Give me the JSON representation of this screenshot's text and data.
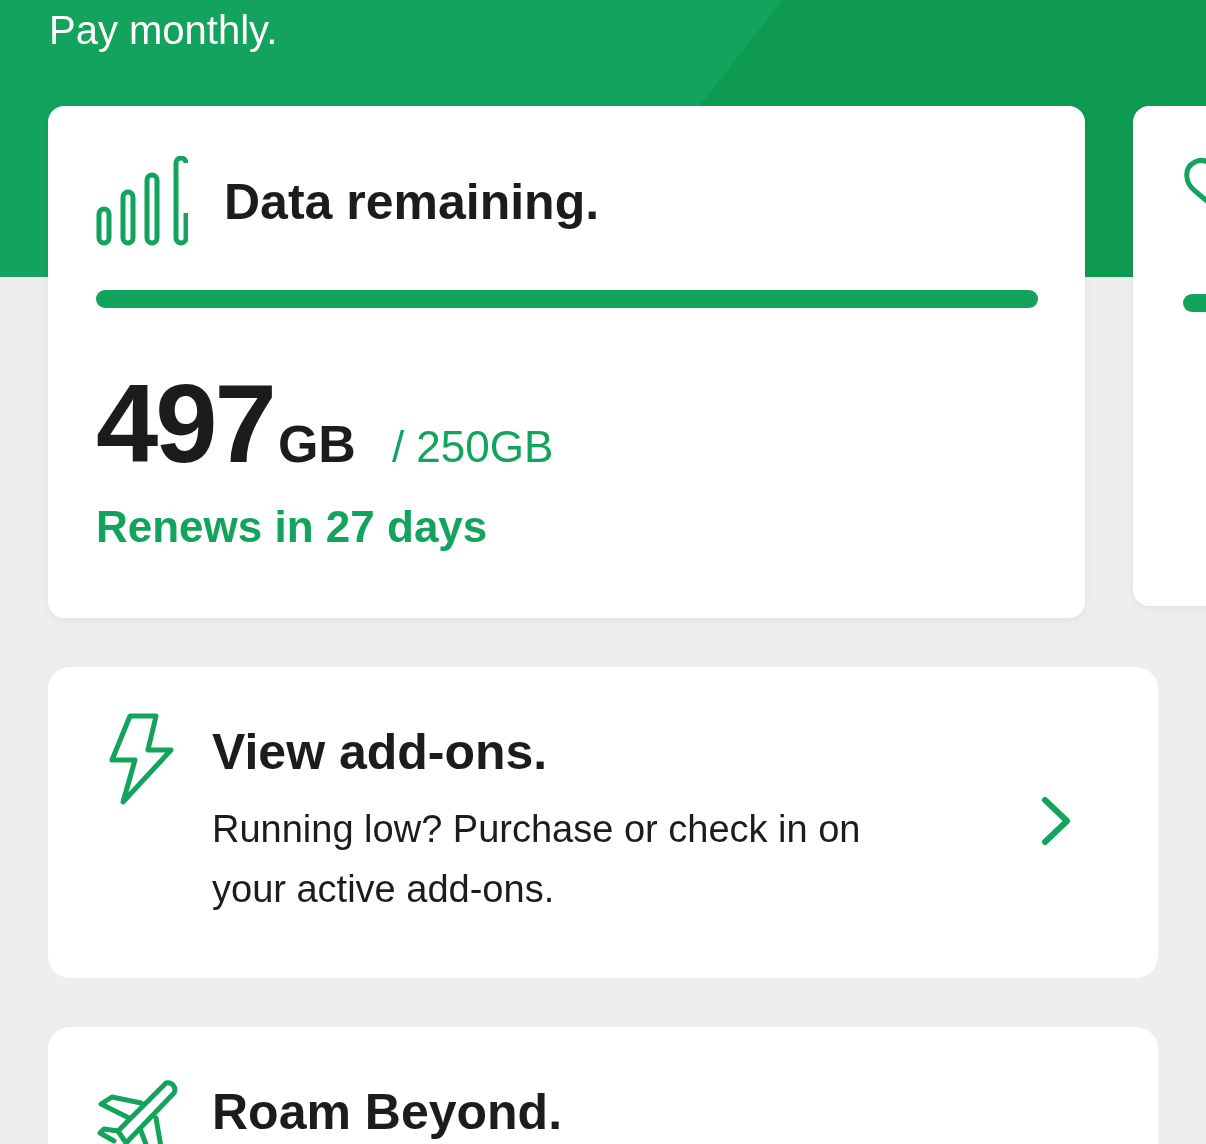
{
  "header": {
    "subtitle": "Pay monthly."
  },
  "usage_cards": [
    {
      "kind": "data",
      "title": "Data remaining.",
      "level": 1,
      "amount": "497",
      "unit": "GB",
      "allowance": "/ 250GB",
      "renewal": "Renews in 27 days"
    },
    {
      "kind": "partial"
    }
  ],
  "links": [
    {
      "kind": "addons",
      "title": "View add-ons.",
      "description": "Running low? Purchase or check in on your active add-ons."
    },
    {
      "kind": "roam",
      "title": "Roam Beyond."
    }
  ]
}
